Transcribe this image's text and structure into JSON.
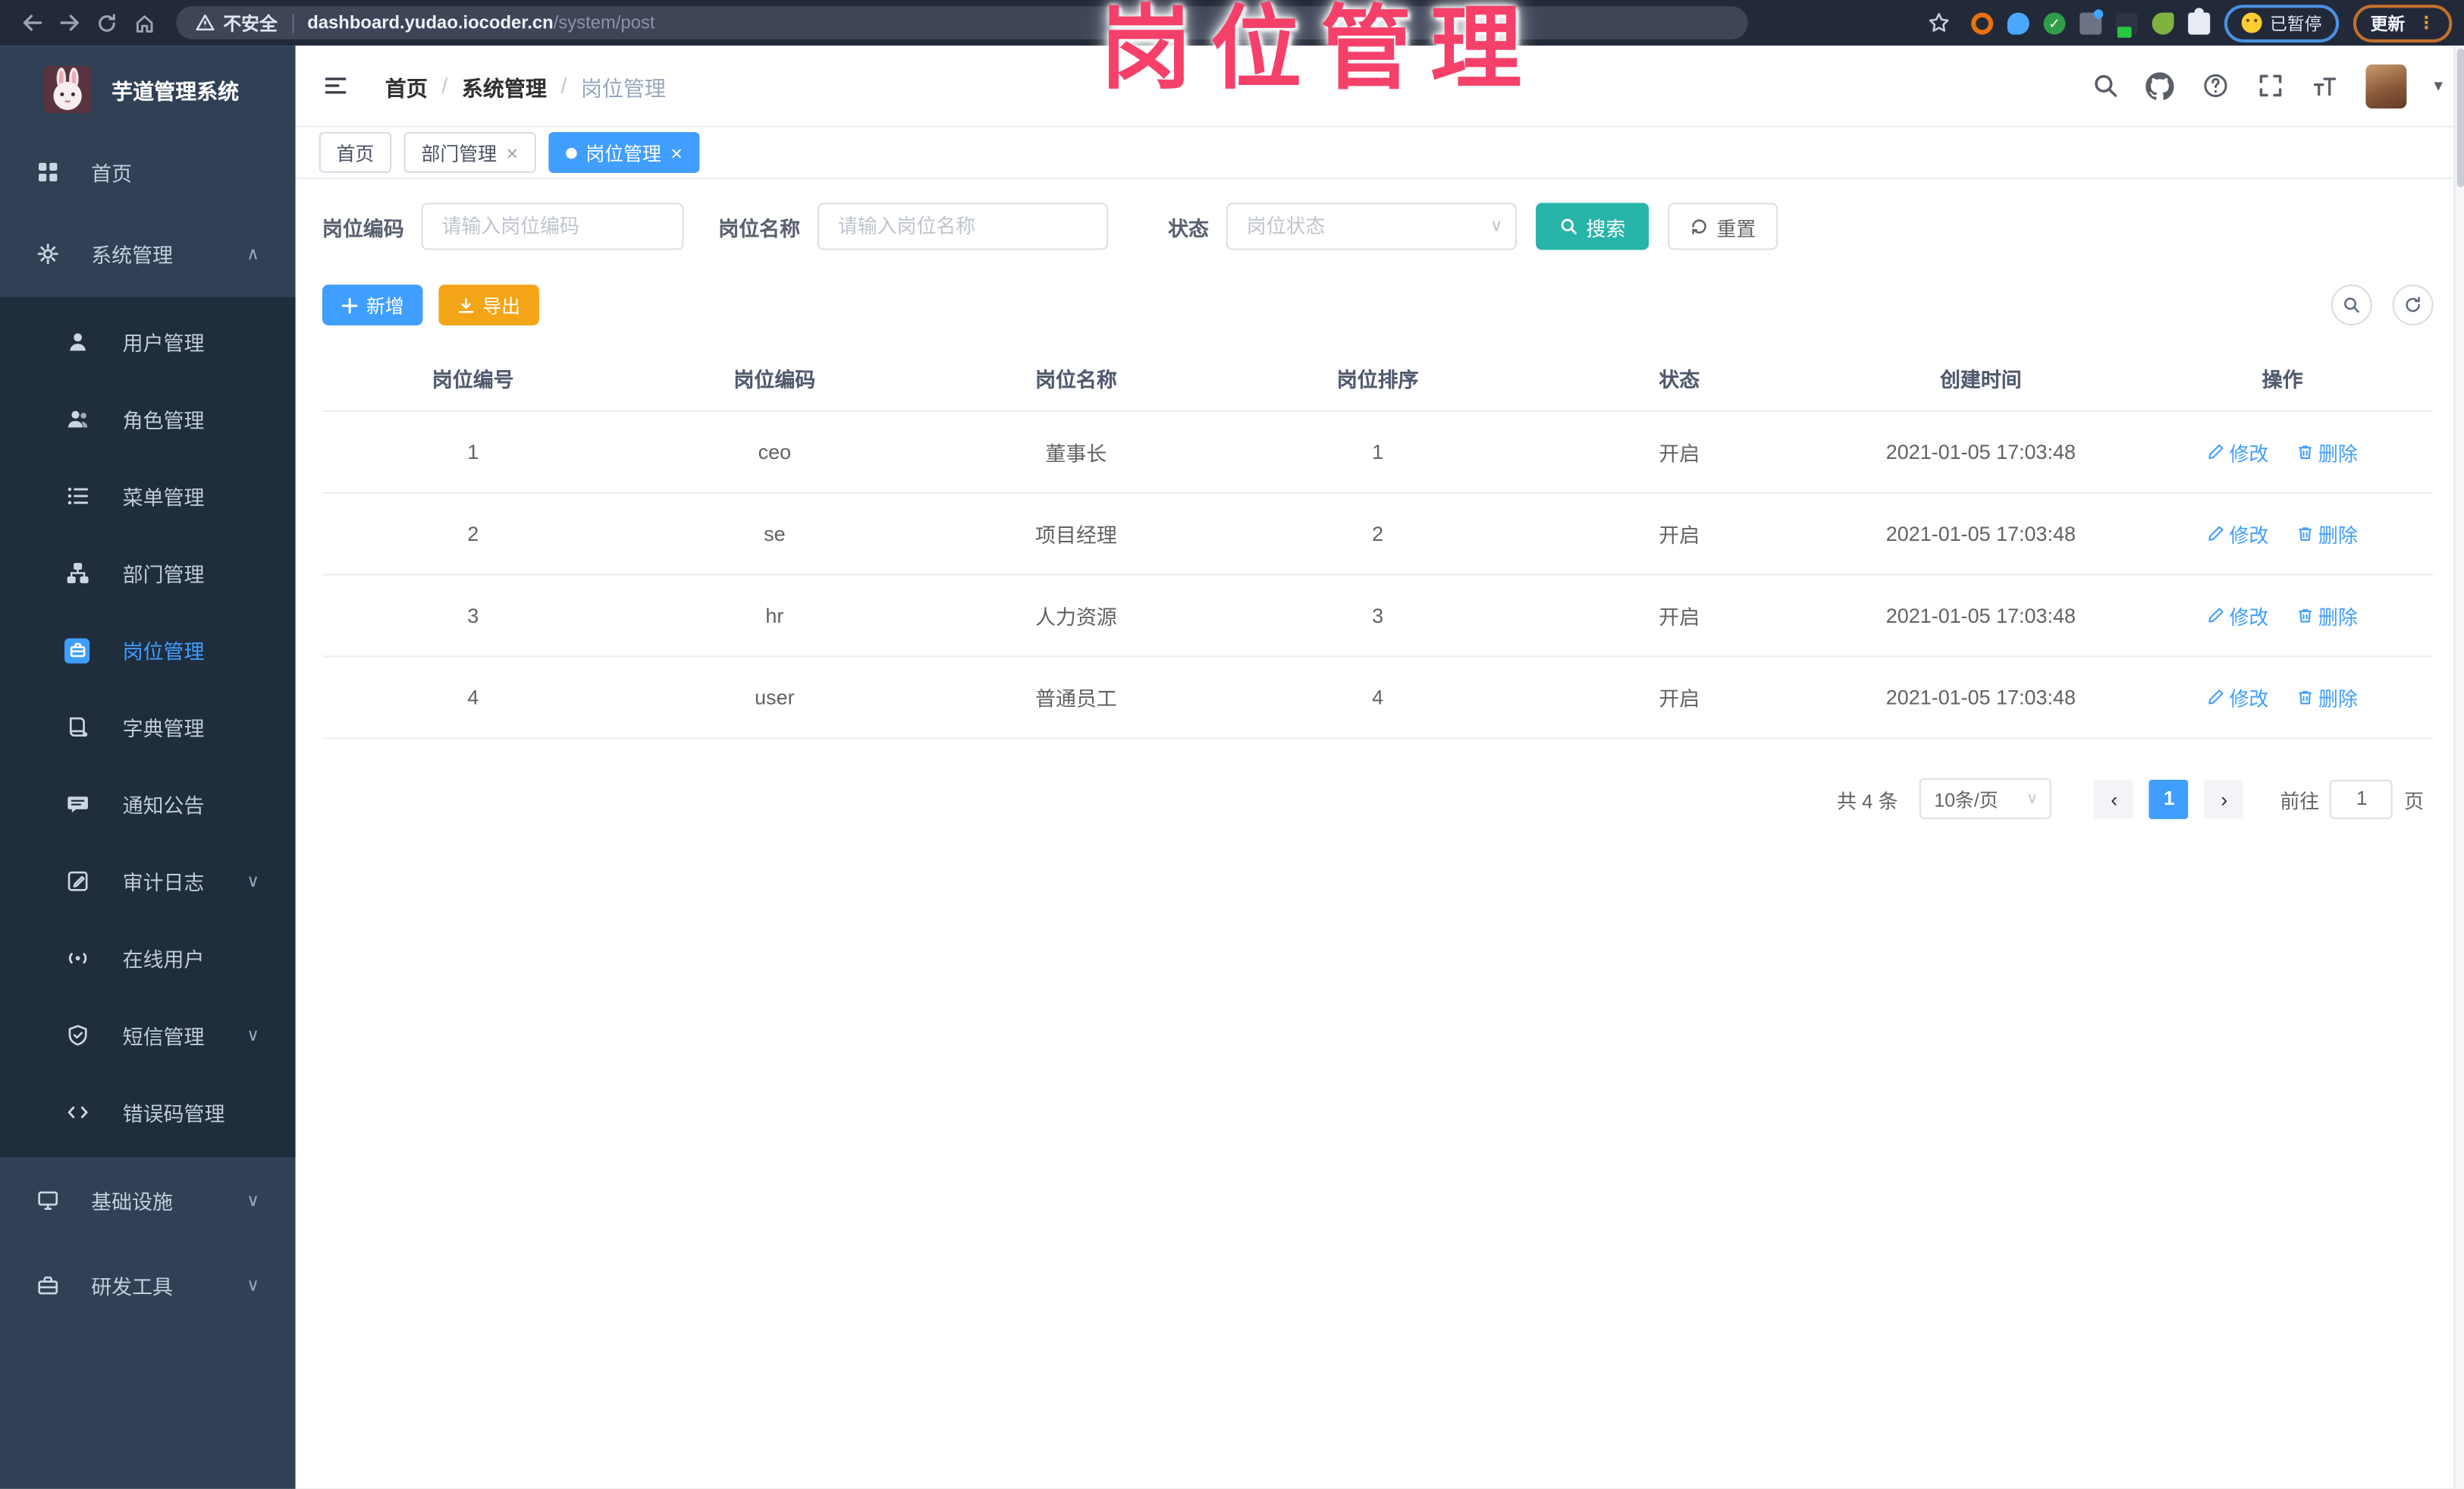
{
  "browser": {
    "security_label": "不安全",
    "url_host": "dashboard.yudao.iocoder.cn",
    "url_path": "/system/post",
    "paused_badge": "已暂停",
    "update_button": "更新"
  },
  "annotation": {
    "title": "岗位管理"
  },
  "sidebar": {
    "logo_title": "芋道管理系统",
    "top_items": [
      {
        "label": "首页",
        "icon": "dashboard-icon"
      },
      {
        "label": "系统管理",
        "icon": "gear-icon",
        "state": "expanded"
      }
    ],
    "system_children": [
      {
        "label": "用户管理",
        "icon": "user-icon"
      },
      {
        "label": "角色管理",
        "icon": "role-icon"
      },
      {
        "label": "菜单管理",
        "icon": "menu-list-icon"
      },
      {
        "label": "部门管理",
        "icon": "department-tree-icon"
      },
      {
        "label": "岗位管理",
        "icon": "post-briefcase-icon",
        "active": true
      },
      {
        "label": "字典管理",
        "icon": "dictionary-icon"
      },
      {
        "label": "通知公告",
        "icon": "announcement-icon"
      },
      {
        "label": "审计日志",
        "icon": "audit-log-icon",
        "expandable": true
      },
      {
        "label": "在线用户",
        "icon": "online-users-icon"
      },
      {
        "label": "短信管理",
        "icon": "sms-shield-icon",
        "expandable": true
      },
      {
        "label": "错误码管理",
        "icon": "error-code-icon"
      }
    ],
    "bottom_items": [
      {
        "label": "基础设施",
        "icon": "infrastructure-icon",
        "expandable": true
      },
      {
        "label": "研发工具",
        "icon": "dev-tools-icon",
        "expandable": true
      }
    ]
  },
  "header": {
    "breadcrumb_home": "首页",
    "breadcrumb_section": "系统管理",
    "breadcrumb_current": "岗位管理"
  },
  "tabs": {
    "items": [
      {
        "label": "首页",
        "closable": false,
        "active": false
      },
      {
        "label": "部门管理",
        "closable": true,
        "active": false
      },
      {
        "label": "岗位管理",
        "closable": true,
        "active": true
      }
    ]
  },
  "filters": {
    "code_label": "岗位编码",
    "code_placeholder": "请输入岗位编码",
    "name_label": "岗位名称",
    "name_placeholder": "请输入岗位名称",
    "status_label": "状态",
    "status_placeholder": "岗位状态",
    "search_button": "搜索",
    "reset_button": "重置"
  },
  "toolbar": {
    "add_button": "新增",
    "export_button": "导出"
  },
  "table": {
    "headers": [
      "岗位编号",
      "岗位编码",
      "岗位名称",
      "岗位排序",
      "状态",
      "创建时间",
      "操作"
    ],
    "rows": [
      {
        "id": "1",
        "code": "ceo",
        "name": "董事长",
        "sort": "1",
        "status": "开启",
        "created": "2021-01-05 17:03:48"
      },
      {
        "id": "2",
        "code": "se",
        "name": "项目经理",
        "sort": "2",
        "status": "开启",
        "created": "2021-01-05 17:03:48"
      },
      {
        "id": "3",
        "code": "hr",
        "name": "人力资源",
        "sort": "3",
        "status": "开启",
        "created": "2021-01-05 17:03:48"
      },
      {
        "id": "4",
        "code": "user",
        "name": "普通员工",
        "sort": "4",
        "status": "开启",
        "created": "2021-01-05 17:03:48"
      }
    ],
    "actions": {
      "edit": "修改",
      "delete": "删除"
    }
  },
  "pagination": {
    "total": "共 4 条",
    "page_size": "10条/页",
    "active_page": "1",
    "goto_label": "前往",
    "goto_value": "1",
    "page_unit": "页"
  },
  "colors": {
    "primary": "#409eff",
    "search_teal": "#28b4a8",
    "export_amber": "#f3a517",
    "annotation_pink": "#f5406a",
    "sidebar_bg": "#304156",
    "submenu_bg": "#1f2d3d"
  }
}
